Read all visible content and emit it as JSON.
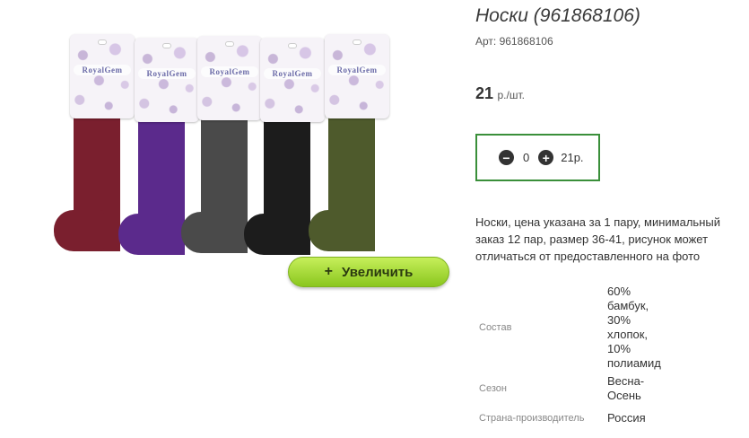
{
  "product": {
    "title": "Носки (961868106)",
    "article": "Арт: 961868106",
    "price_value": "21",
    "price_unit": "р./шт.",
    "description": "Носки, цена указана за 1 пару, минимальный заказ 12 пар, размер 36-41, рисунок может отличаться от предоставленного на фото"
  },
  "image": {
    "brand_text": "RoyalGem",
    "sock_colors": [
      "#7a1f2e",
      "#5b2a8c",
      "#4a4a4a",
      "#1c1c1c",
      "#4e5a2c"
    ],
    "zoom_label": "Увеличить"
  },
  "quantity": {
    "value": "0",
    "total": "21р."
  },
  "specs": [
    {
      "label": "Состав",
      "value": "60%\nбамбук,\n30%\nхлопок,\n10%\nполиамид"
    },
    {
      "label": "Сезон",
      "value": "Весна-\nОсень"
    },
    {
      "label": "Страна-производитель",
      "value": "Россия"
    }
  ],
  "colors": {
    "accent_green": "#8ac61e",
    "qty_border": "#3a8f3a"
  }
}
